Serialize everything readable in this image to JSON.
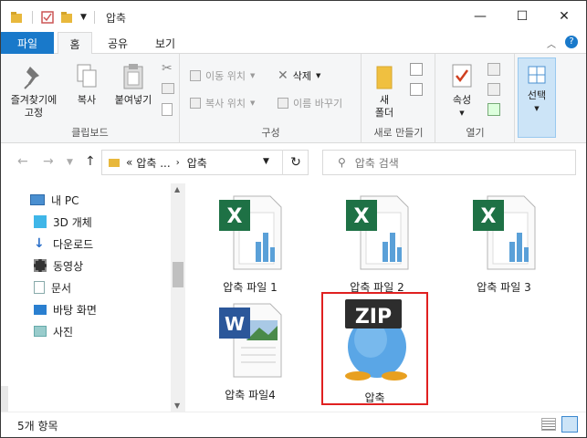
{
  "window": {
    "title": "압축"
  },
  "tabs": [
    {
      "label": "파일"
    },
    {
      "label": "홈"
    },
    {
      "label": "공유"
    },
    {
      "label": "보기"
    }
  ],
  "ribbon": {
    "clipboard": {
      "label": "클립보드",
      "pin": "즐겨찾기에\n고정",
      "copy": "복사",
      "paste": "붙여넣기"
    },
    "organize": {
      "label": "구성",
      "move": "이동 위치",
      "copyto": "복사 위치",
      "delete": "삭제",
      "rename": "이름 바꾸기"
    },
    "new": {
      "label": "새로 만들기",
      "folder": "새\n폴더"
    },
    "open": {
      "label": "열기",
      "props": "속성"
    },
    "select": {
      "label": "선택"
    }
  },
  "address": {
    "path_prefix": "«",
    "crumb1": "압축 ...",
    "crumb2": "압축",
    "search_placeholder": "압축 검색"
  },
  "nav": {
    "items": [
      {
        "label": "내 PC",
        "icon": "pc-icon"
      },
      {
        "label": "3D 개체",
        "icon": "cube-icon"
      },
      {
        "label": "다운로드",
        "icon": "download-icon"
      },
      {
        "label": "동영상",
        "icon": "video-icon"
      },
      {
        "label": "문서",
        "icon": "document-icon"
      },
      {
        "label": "바탕 화면",
        "icon": "desktop-icon"
      },
      {
        "label": "사진",
        "icon": "picture-icon"
      }
    ]
  },
  "files": [
    {
      "name": "압축 파일 1",
      "type": "excel"
    },
    {
      "name": "압축 파일 2",
      "type": "excel"
    },
    {
      "name": "압축 파일 3",
      "type": "excel"
    },
    {
      "name": "압축 파일4",
      "type": "word"
    },
    {
      "name": "압축",
      "type": "zip",
      "badge": "ZIP"
    }
  ],
  "status": {
    "count": "5개 항목"
  },
  "colors": {
    "accent": "#1979ca",
    "selection_border": "#e02020",
    "excel": "#1e7145",
    "word": "#2b579a"
  }
}
